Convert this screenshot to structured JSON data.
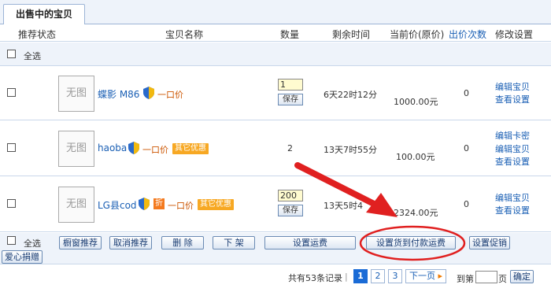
{
  "tab": {
    "label": "出售中的宝贝"
  },
  "columns": {
    "recommend": "推荐状态",
    "name": "宝贝名称",
    "qty": "数量",
    "remaining": "剩余时间",
    "price": "当前价(原价)",
    "bids": "出价次数",
    "modify": "修改设置"
  },
  "select_all": "全选",
  "thumb_text": "无图",
  "items": [
    {
      "name": "蝶影 M86",
      "fixed_price": "一口价",
      "qty_input": "1",
      "save": "保存",
      "remaining": "6天22时12分",
      "price": "1000.00元",
      "bids": "0",
      "actions": [
        "编辑宝贝",
        "查看设置"
      ]
    },
    {
      "name": "haoba",
      "fixed_price": "一口价",
      "promo": "其它优惠",
      "qty": "2",
      "remaining": "13天7时55分",
      "price": "100.00元",
      "bids": "0",
      "actions": [
        "编辑卡密",
        "编辑宝贝",
        "查看设置"
      ]
    },
    {
      "name": "LG县cod",
      "zhe": "折",
      "fixed_price": "一口价",
      "promo": "其它优惠",
      "qty_input": "200",
      "save": "保存",
      "remaining": "13天5时4",
      "price": "2324.00元",
      "bids": "0",
      "actions": [
        "编辑宝贝",
        "查看设置"
      ]
    }
  ],
  "bottom_buttons": {
    "window_recommend": "橱窗推荐",
    "cancel_recommend": "取消推荐",
    "delete": "删 除",
    "offshelf": "下 架",
    "set_shipping": "设置运费",
    "set_cod_shipping": "设置货到付款运费",
    "set_promo": "设置促销",
    "donate": "爱心捐赠"
  },
  "pager": {
    "summary": "共有53条记录",
    "pages": [
      "1",
      "2",
      "3"
    ],
    "next": "下一页",
    "goto_prefix": "到第",
    "goto_suffix": "页",
    "confirm": "确定"
  },
  "colors": {
    "accent": "#1a5fb4",
    "highlight": "#e02020",
    "header_bg": "#eef3fa"
  }
}
